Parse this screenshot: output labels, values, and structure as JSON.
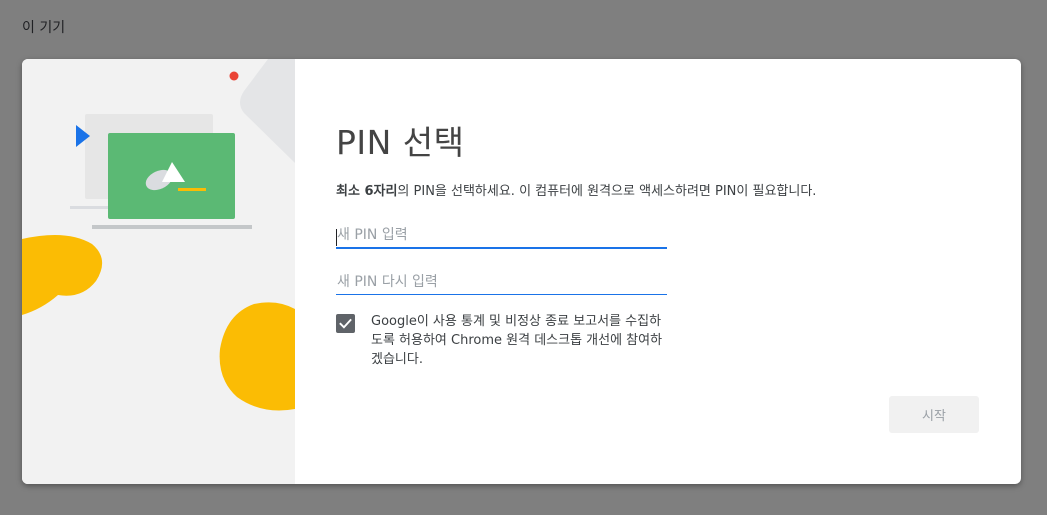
{
  "page": {
    "heading": "이 기기"
  },
  "dialog": {
    "title": "PIN 선택",
    "description_bold": "최소 6자리",
    "description_rest": "의 PIN을 선택하세요. 이 컴퓨터에 원격으로 액세스하려면 PIN이 필요합니다.",
    "pin_input": {
      "placeholder": "새 PIN 입력",
      "value": ""
    },
    "pin_confirm": {
      "placeholder": "새 PIN 다시 입력",
      "value": ""
    },
    "consent": {
      "checked": true,
      "label": "Google이 사용 통계 및 비정상 종료 보고서를 수집하도록 허용하여 Chrome 원격 데스크톱 개선에 참여하겠습니다."
    },
    "start_button_label": "시작",
    "start_button_enabled": false
  },
  "colors": {
    "overlay": "#7f7f7f",
    "accent_blue": "#1a73e8",
    "illustration_green": "#5bb974",
    "illustration_yellow": "#fbbc04",
    "illustration_red": "#ea4335",
    "checkbox_fill": "#5f6368"
  },
  "icons": {
    "checkbox": "check-icon",
    "illustration": "laptop-illustration"
  }
}
